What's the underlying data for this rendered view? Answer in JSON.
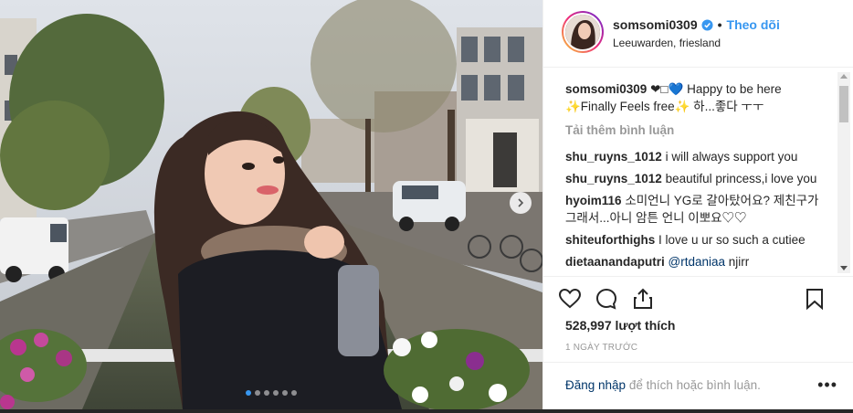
{
  "post": {
    "username": "somsomi0309",
    "follow_separator": "•",
    "follow_label": "Theo dõi",
    "location": "Leeuwarden, friesland",
    "caption_user": "somsomi0309",
    "caption_text": "❤□💙 Happy to be here ✨Finally Feels free✨ 하...좋다 ㅜㅜ",
    "load_more": "Tải thêm bình luận",
    "comments": [
      {
        "user": "shu_ruyns_1012",
        "text": "i will always support you"
      },
      {
        "user": "shu_ruyns_1012",
        "text": "beautiful princess,i love you"
      },
      {
        "user": "hyoim116",
        "text": "소미언니 YG로 갈아탔어요? 제친구가 그래서...아니 암튼 언니 이뽀요♡♡"
      },
      {
        "user": "shiteuforthighs",
        "text": "I love u ur so such a cutiee"
      },
      {
        "user": "dietaanandaputri",
        "mention": "@rtdaniaa",
        "text": "njirr"
      }
    ],
    "likes": "528,997 lượt thích",
    "time_ago": "1 NGÀY TRƯỚC",
    "login_link": "Đăng nhập",
    "login_rest": " để thích hoặc bình luận.",
    "more_label": "•••"
  },
  "icons": {
    "like": "heart-icon",
    "comment": "comment-icon",
    "share": "share-icon",
    "save": "bookmark-icon",
    "verified": "verified-badge-icon",
    "next": "chevron-right-icon"
  },
  "colors": {
    "accent": "#3897f0",
    "text": "#262626",
    "muted": "#999999",
    "link": "#003569"
  },
  "carousel": {
    "slides": 6,
    "active": 1
  }
}
